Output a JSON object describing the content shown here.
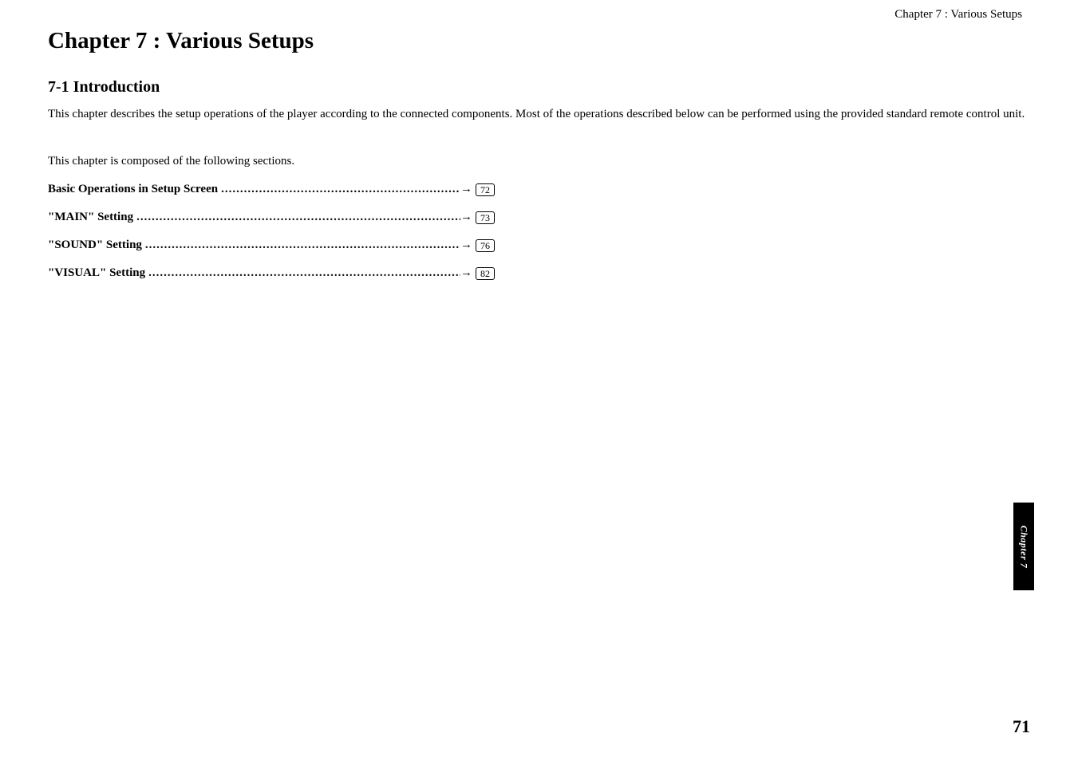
{
  "header": {
    "runningHead": "Chapter 7 : Various Setups"
  },
  "title": "Chapter 7 : Various Setups",
  "section": {
    "number": "7-1",
    "title": "Introduction",
    "heading": "7-1   Introduction"
  },
  "introParagraph": "This chapter describes the setup operations of the player according to the connected components. Most of the operations described below can be performed using the provided standard remote control unit.",
  "sectionsIntro": "This chapter is composed of the following sections.",
  "toc": [
    {
      "label": "Basic Operations in Setup Screen ",
      "page": "72"
    },
    {
      "label": "\"MAIN\" Setting ",
      "page": "73"
    },
    {
      "label": "\"SOUND\" Setting ",
      "page": "76"
    },
    {
      "label": "\"VISUAL\" Setting ",
      "page": "82"
    }
  ],
  "arrow": "→",
  "dots": ".........................................................................................",
  "sideTab": "Chapter 7",
  "pageNumber": "71"
}
